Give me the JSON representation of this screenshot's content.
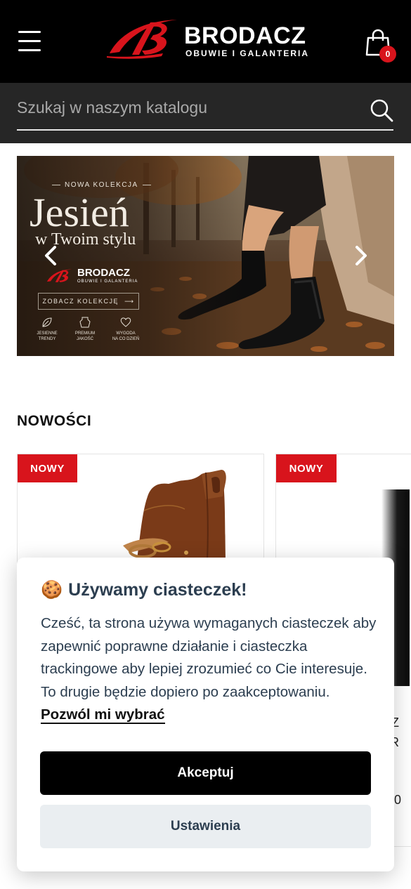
{
  "header": {
    "brand_name": "BRODACZ",
    "brand_tagline": "OBUWIE I GALANTERIA",
    "cart_count": "0"
  },
  "search": {
    "placeholder": "Szukaj w naszym katalogu",
    "value": ""
  },
  "banner": {
    "kicker": "NOWA KOLEKCJA",
    "title": "Jesień",
    "subtitle": "w Twoim stylu",
    "logo_name": "BRODACZ",
    "logo_tagline": "OBUWIE I GALANTERIA",
    "cta": "ZOBACZ KOLEKCJĘ",
    "features": [
      {
        "line1": "JESIENNE",
        "line2": "TRENDY",
        "icon": "leaf-icon"
      },
      {
        "line1": "PREMIUM",
        "line2": "JAKOŚĆ",
        "icon": "leather-icon"
      },
      {
        "line1": "WYGODA",
        "line2": "NA CO DZIEŃ",
        "icon": "heart-icon"
      }
    ]
  },
  "new_section": {
    "title": "NOWOŚCI",
    "products": [
      {
        "badge": "NOWY"
      },
      {
        "badge": "NOWY",
        "frag1": "Z",
        "frag2": "R",
        "frag3": "0"
      }
    ]
  },
  "cookie": {
    "emoji": "🍪",
    "title": "Używamy ciasteczek!",
    "body": "Cześć, ta strona używa wymaganych ciasteczek aby zapewnić poprawne działanie i ciasteczka trackingowe aby lepiej zrozumieć co Cie interesuje. To drugie będzie dopiero po zaakceptowaniu.",
    "link": "Pozwól mi wybrać",
    "accept": "Akceptuj",
    "settings": "Ustawienia"
  },
  "colors": {
    "brand_red": "#d8141c",
    "header_bg": "#000000",
    "search_bg": "#262626",
    "cookie_text": "#2c3e50"
  }
}
